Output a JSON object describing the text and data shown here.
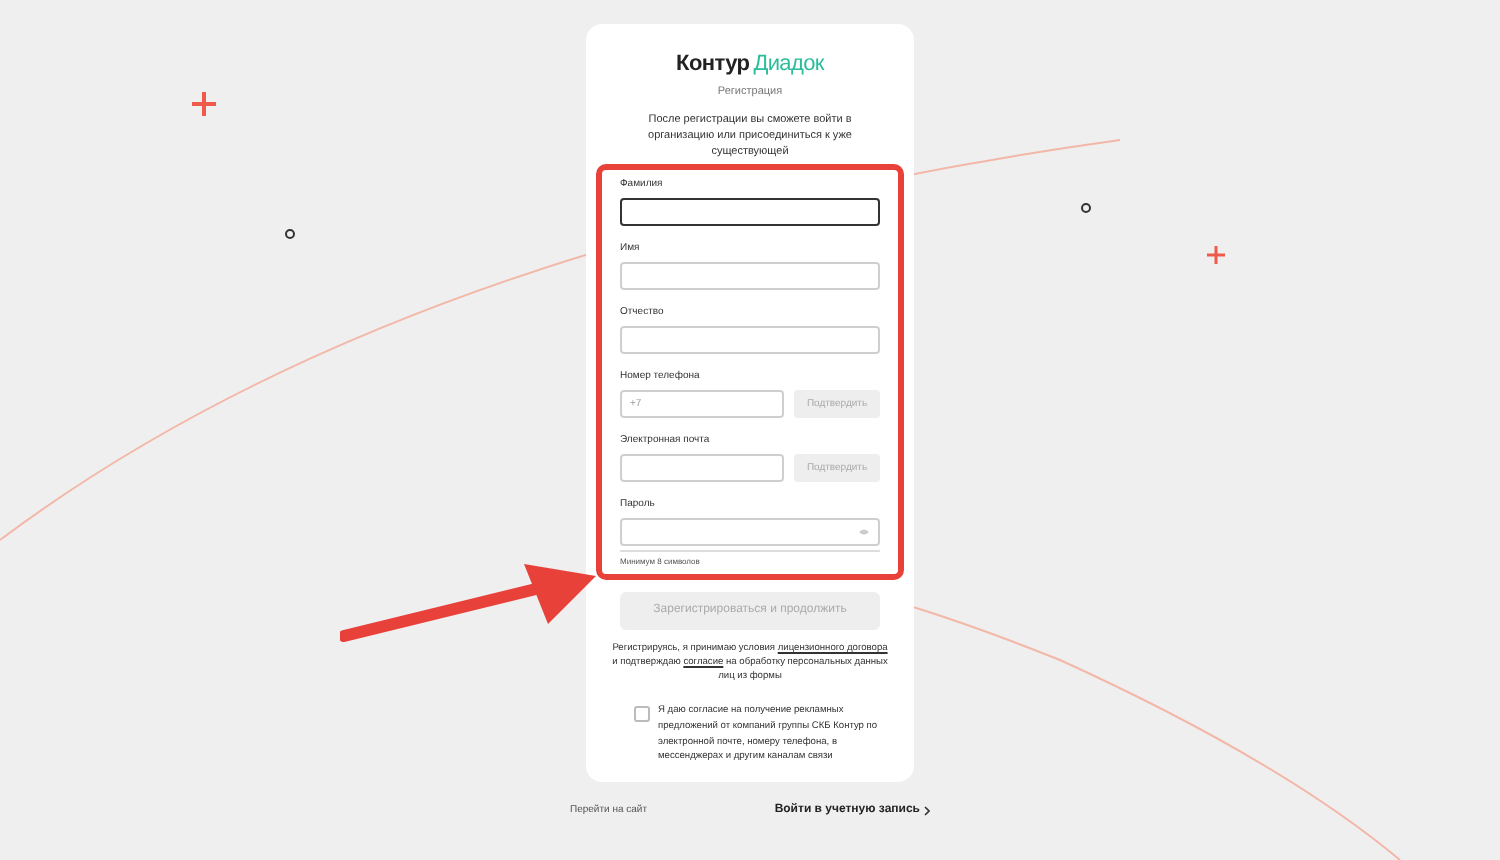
{
  "logo": {
    "brand": "Контур",
    "product": "Диадок"
  },
  "subtitle": "Регистрация",
  "intro": "После регистрации вы сможете войти в организацию или присоединиться к уже существующей",
  "fields": [
    {
      "label": "Фамилия",
      "kind": "text",
      "focused": true
    },
    {
      "label": "Имя",
      "kind": "text",
      "focused": false
    },
    {
      "label": "Отчество",
      "kind": "text",
      "focused": false
    },
    {
      "label": "Номер телефона",
      "kind": "confirm",
      "placeholder": "+7",
      "button": "Подтвердить",
      "focused": false
    },
    {
      "label": "Электронная почта",
      "kind": "confirm",
      "button": "Подтвердить",
      "focused": false
    },
    {
      "label": "Пароль",
      "kind": "password",
      "hint": "Минимум 8 символов",
      "focused": false
    }
  ],
  "submit": {
    "label": "Зарегистрироваться и продолжить",
    "disabled": true
  },
  "terms": [
    {
      "kind": "plain",
      "text": "Регистрируясь, я принимаю условия "
    },
    {
      "kind": "link",
      "text": "лицензионного договора"
    },
    {
      "kind": "plain",
      "text": " и подтверждаю "
    },
    {
      "kind": "link",
      "text": "согласие"
    },
    {
      "kind": "plain",
      "text": " на обработку персональных данных лиц из формы"
    }
  ],
  "marketing": {
    "text": "Я даю согласие на получение рекламных предложений от компаний группы СКБ Контур по электронной почте, номеру телефона, в мессенджерах и другим каналам связи",
    "checked": false
  },
  "footer": {
    "site_link": "Перейти на сайт",
    "login_link": "Войти в учетную запись"
  }
}
